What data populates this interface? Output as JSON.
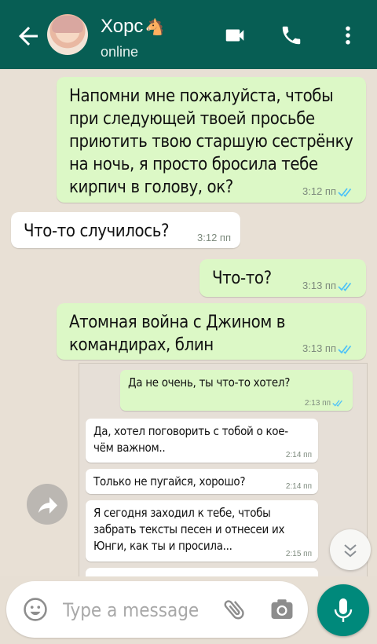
{
  "header": {
    "contact_name": "Хорс",
    "contact_emoji": "🐴",
    "status": "online",
    "colors": {
      "bar": "#075e54",
      "accent": "#00897b"
    }
  },
  "messages": [
    {
      "direction": "out",
      "text": "Напомни мне пожалуйста, чтобы при следующей твоей просьбе приютить твою старшую сестрёнку на ночь, я просто бросила тебе кирпич в голову, ок?",
      "time": "3:12 пп",
      "read": true
    },
    {
      "direction": "in",
      "text": "Что-то случилось?",
      "time": "3:12 пп"
    },
    {
      "direction": "out",
      "text": "Что-то?",
      "time": "3:13 пп",
      "read": true
    },
    {
      "direction": "out",
      "text": "Атомная война с Джином в командирах, блин",
      "time": "3:13 пп",
      "read": true
    }
  ],
  "forwarded_screenshot": {
    "messages": [
      {
        "direction": "out",
        "text": "Да не очень, ты что-то хотел?",
        "time": "2:13 пп"
      },
      {
        "direction": "in",
        "text": "Да, хотел поговорить с тобой о кое-чём важном..",
        "time": "2:14 пп"
      },
      {
        "direction": "in",
        "text": "Только не пугайся, хорошо?",
        "time": "2:14 пп"
      },
      {
        "direction": "in",
        "text": "Я сегодня заходил к тебе, чтобы забрать тексты песен и отнесеи их Юнги, как ты и просила...",
        "time": "2:15 пп"
      }
    ]
  },
  "composer": {
    "placeholder": "Type a message"
  },
  "icons": {
    "back": "arrow-back-icon",
    "video": "video-call-icon",
    "call": "phone-icon",
    "menu": "more-vert-icon",
    "emoji": "emoji-icon",
    "attach": "paperclip-icon",
    "camera": "camera-icon",
    "mic": "mic-icon",
    "forward": "forward-icon",
    "scroll": "scroll-down-icon"
  }
}
